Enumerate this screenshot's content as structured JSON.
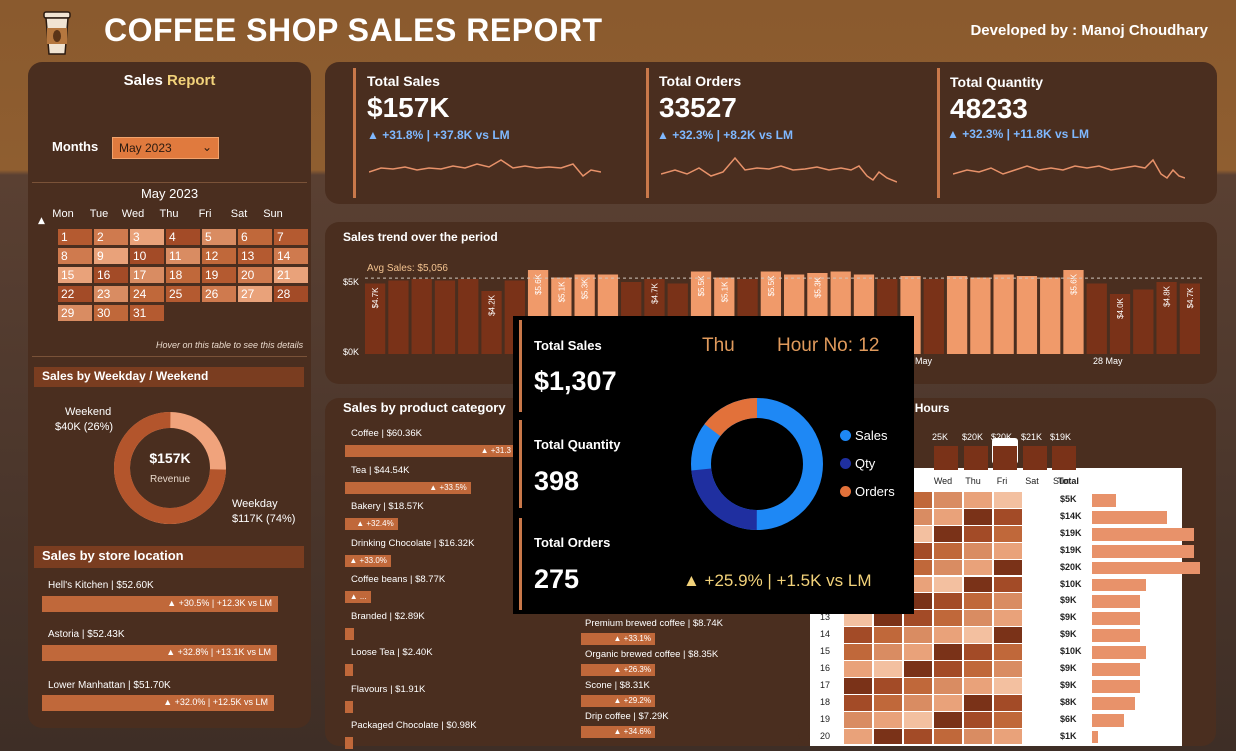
{
  "header": {
    "title": "COFFEE SHOP SALES REPORT",
    "developer": "Developed by : Manoj Choudhary"
  },
  "left": {
    "title_a": "Sales",
    "title_b": "Report",
    "months_label": "Months",
    "month_value": "May 2023",
    "calendar_title": "May 2023",
    "weekdays": [
      "Mon",
      "Tue",
      "Wed",
      "Thu",
      "Fri",
      "Sat",
      "Sun"
    ],
    "hover_note": "Hover on this table to see this details",
    "weekday_section": "Sales by Weekday / Weekend",
    "donut_center_value": "$157K",
    "donut_center_label": "Revenue",
    "weekend_label": "Weekend",
    "weekend_value": "$40K (26%)",
    "weekday_label": "Weekday",
    "weekday_value": "$117K (74%)",
    "store_section": "Sales by store location",
    "stores": [
      {
        "name": "Hell's Kitchen | $52.60K",
        "delta": "▲ +30.5% | +12.3K vs LM"
      },
      {
        "name": "Astoria | $52.43K",
        "delta": "▲ +32.8% | +13.1K vs LM"
      },
      {
        "name": "Lower Manhattan | $51.70K",
        "delta": "▲ +32.0% | +12.5K vs LM"
      }
    ]
  },
  "kpis": [
    {
      "name": "Total Sales",
      "value": "$157K",
      "delta": "▲ +31.8% | +37.8K vs LM"
    },
    {
      "name": "Total Orders",
      "value": "33527",
      "delta": "▲ +32.3% | +8.2K vs LM"
    },
    {
      "name": "Total Quantity",
      "value": "48233",
      "delta": "▲ +32.3% | +11.8K vs LM"
    }
  ],
  "trend": {
    "title": "Sales trend over the period",
    "avg_label": "Avg Sales: $5,056",
    "y_top": "$5K",
    "y_bottom": "$0K",
    "x_label_1": "May",
    "x_label_2": "28 May"
  },
  "categories": {
    "title": "Sales by product category",
    "items": [
      {
        "label": "Coffee | $60.36K",
        "delta": "▲ +31.3",
        "frac": 1.0
      },
      {
        "label": "Tea | $44.54K",
        "delta": "▲ +33.5%",
        "frac": 0.74
      },
      {
        "label": "Bakery | $18.57K",
        "delta": "▲ +32.4%",
        "frac": 0.31
      },
      {
        "label": "Drinking Chocolate | $16.32K",
        "delta": "▲ +33.0%",
        "frac": 0.27
      },
      {
        "label": "Coffee beans | $8.77K",
        "delta": "▲ ...",
        "frac": 0.15
      },
      {
        "label": "Branded | $2.89K",
        "delta": "",
        "frac": 0.05
      },
      {
        "label": "Loose Tea | $2.40K",
        "delta": "",
        "frac": 0.04
      },
      {
        "label": "Flavours | $1.91K",
        "delta": "",
        "frac": 0.03
      },
      {
        "label": "Packaged Chocolate | $0.98K",
        "delta": "",
        "frac": 0.02
      }
    ],
    "types": [
      {
        "label": "Premium brewed coffee | $8.74K",
        "delta": "▲ +33.1%"
      },
      {
        "label": "Organic brewed coffee | $8.35K",
        "delta": "▲ +26.3%"
      },
      {
        "label": "Scone | $8.31K",
        "delta": "▲ +29.2%"
      },
      {
        "label": "Drip coffee | $7.29K",
        "delta": "▲ +34.6%"
      }
    ]
  },
  "heatmap": {
    "title": "s | Hours",
    "day_heads": [
      "Wed",
      "Thu",
      "Fri",
      "Sat",
      "Sun"
    ],
    "total_head": "Total",
    "top_values": [
      "25K",
      "$20K",
      "$20K",
      "$21K",
      "$19K"
    ],
    "hours": [
      "13",
      "14",
      "15",
      "16",
      "17",
      "18",
      "19",
      "20"
    ],
    "totals": [
      "$5K",
      "$14K",
      "$19K",
      "$19K",
      "$20K",
      "$10K",
      "$9K",
      "$9K",
      "$9K",
      "$10K",
      "$9K",
      "$9K",
      "$8K",
      "$6K",
      "$1K"
    ],
    "total_fracs": [
      0.22,
      0.68,
      0.93,
      0.93,
      0.98,
      0.49,
      0.44,
      0.44,
      0.44,
      0.49,
      0.44,
      0.44,
      0.39,
      0.29,
      0.05
    ]
  },
  "tooltip": {
    "day": "Thu",
    "hour": "Hour No: 12",
    "sales_label": "Total Sales",
    "sales_value": "$1,307",
    "qty_label": "Total Quantity",
    "qty_value": "398",
    "orders_label": "Total Orders",
    "orders_value": "275",
    "delta": "▲ +25.9% | +1.5K vs LM",
    "legend": [
      "Sales",
      "Qty",
      "Orders"
    ],
    "legend_colors": [
      "#1e88f5",
      "#1f2fa0",
      "#e2713a"
    ]
  },
  "chart_data": [
    {
      "type": "bar",
      "title": "Sales trend over the period",
      "values": [
        4.7,
        4.9,
        5.0,
        4.9,
        5.0,
        4.2,
        4.9,
        5.6,
        5.1,
        5.3,
        5.3,
        4.8,
        5.0,
        4.7,
        5.5,
        5.1,
        5.0,
        5.5,
        5.3,
        5.4,
        5.5,
        5.3,
        5.0,
        5.2,
        5.0,
        5.2,
        5.1,
        5.3,
        5.2,
        5.1,
        5.6,
        4.7,
        4.0,
        4.3,
        4.8,
        4.7
      ],
      "bar_labels": [
        "$4.7K",
        "",
        "",
        "",
        "",
        "$4.2K",
        "",
        "$5.6K",
        "$5.1K",
        "$5.3K",
        "",
        "",
        "$4.7K",
        "",
        "$5.5K",
        "$5.1K",
        "",
        "$5.5K",
        "",
        "$5.3K",
        "",
        "",
        "",
        "",
        "",
        "",
        "",
        "",
        "",
        "",
        "$5.6K",
        "",
        "$4.0K",
        "",
        "$4.8K",
        "$4.7K"
      ],
      "average": 5.056,
      "ylim": [
        0,
        5.6
      ]
    },
    {
      "type": "pie",
      "title": "Sales by Weekday / Weekend",
      "categories": [
        "Weekday",
        "Weekend"
      ],
      "values": [
        117,
        40
      ]
    }
  ]
}
